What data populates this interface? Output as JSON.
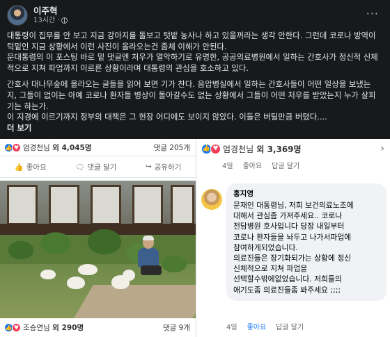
{
  "post": {
    "author": "이주혁",
    "time": "13시간",
    "body": [
      "대통령이 집무를 안 보고 지금 강아지를 돌보고 텃밭 농사나 하고 있을꺼라는 생각 안한다. 그런데 코로나 방역이 턱밑인 지금 상황에서 이런 사진이 올라오는건 좀체 이해가 안된다.",
      "문대통령의 이 포스팅 바로 밑 댓글엔 처우가 열악하기로 유명한, 공공의료병원에서 일하는 간호사가 정신적 신체적으로 지쳐 파업까지 이르른 상황이라며 대통령의 관심을 호소하고 있다.",
      "간호사 대나무숲에 올라오는 글들을 읽어 보면 기가 찬다. 음압병실에서 일하는 간호사들이 어떤 일상을 보냈는지, 그들이 없이는 아예 코로나 환자들 병상이 돌아갈수도 없는 상황에서 그들이 어떤 처우를 받았는지 누가 살피기는 하는가.",
      "이 지경에 이르기까지 정부의 대책은 그 현장 어디에도 보이지 않았다. 이들은 버틸만큼 버텼다...."
    ],
    "see_more": "더 보기"
  },
  "left_card": {
    "top_reactions": {
      "name": "엄경천님",
      "suffix": " 외 4,045명",
      "comments": "댓글 205개"
    },
    "actions": {
      "like": "좋아요",
      "comment": "댓글 달기",
      "share": "공유하기"
    },
    "bottom_reactions": {
      "name": "조승연님",
      "suffix": " 외 290명",
      "comments": "댓글 9개"
    }
  },
  "right_card": {
    "top_reactions": {
      "name": "엄경천님",
      "suffix": " 외 3,369명"
    },
    "meta": {
      "time": "4일",
      "like": "좋아요",
      "reply": "답글 달기"
    },
    "comment": {
      "author": "홍지영",
      "text": "문재인 대통령님, 저희 보건의료노조에\n대해서 관심좀 가져주세요.. 코로나\n전담병원 호사입니다 당장 내일부터\n코로나 환자들을 놔두고 나가서파업에\n참여하게되었습니다.\n의료진들은 장기화되가는 상황에 정신\n신체적으로 지쳐 파업을\n선택할수밖에없었습니다. 저희들의\n애기도좀 의료진들좀 봐주세요 ;;;;"
    },
    "reply_meta": {
      "time": "4일",
      "like": "좋아요",
      "reply": "답글 달기"
    }
  },
  "colors": {
    "dark_bg": "#18191a",
    "link_blue": "#1877f2",
    "like_blue": "#1877f2",
    "love_red": "#f33e58"
  }
}
